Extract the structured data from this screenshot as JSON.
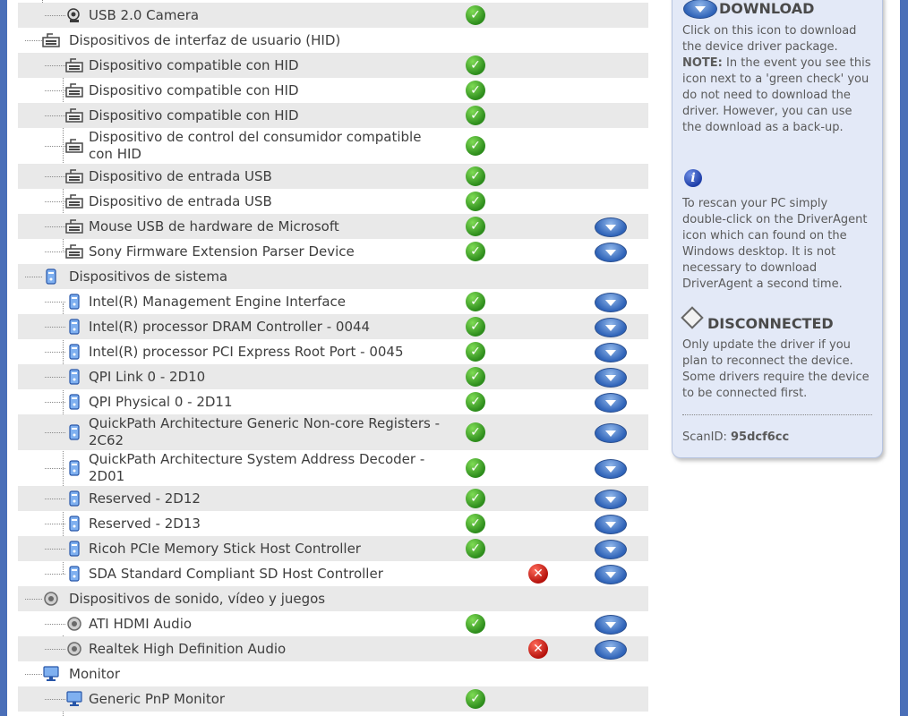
{
  "tree_rows": [
    {
      "label": "USB 2.0 Camera",
      "icon": "camera-icon",
      "level": 1,
      "ok": true,
      "err": false,
      "download": false
    },
    {
      "label": "Dispositivos de interfaz de usuario (HID)",
      "icon": "keyboard-icon",
      "level": 0,
      "ok": false,
      "err": false,
      "download": false
    },
    {
      "label": "Dispositivo compatible con HID",
      "icon": "keyboard-icon",
      "level": 1,
      "ok": true,
      "err": false,
      "download": false
    },
    {
      "label": "Dispositivo compatible con HID",
      "icon": "keyboard-icon",
      "level": 1,
      "ok": true,
      "err": false,
      "download": false
    },
    {
      "label": "Dispositivo compatible con HID",
      "icon": "keyboard-icon",
      "level": 1,
      "ok": true,
      "err": false,
      "download": false
    },
    {
      "label": "Dispositivo de control del consumidor compatible con HID",
      "icon": "keyboard-icon",
      "level": 1,
      "ok": true,
      "err": false,
      "download": false
    },
    {
      "label": "Dispositivo de entrada USB",
      "icon": "keyboard-icon",
      "level": 1,
      "ok": true,
      "err": false,
      "download": false
    },
    {
      "label": "Dispositivo de entrada USB",
      "icon": "keyboard-icon",
      "level": 1,
      "ok": true,
      "err": false,
      "download": false
    },
    {
      "label": "Mouse USB de hardware de Microsoft",
      "icon": "keyboard-icon",
      "level": 1,
      "ok": true,
      "err": false,
      "download": true
    },
    {
      "label": "Sony Firmware Extension Parser Device",
      "icon": "keyboard-icon",
      "level": 1,
      "ok": true,
      "err": false,
      "download": true
    },
    {
      "label": "Dispositivos de sistema",
      "icon": "computer-icon",
      "level": 0,
      "ok": false,
      "err": false,
      "download": false
    },
    {
      "label": "Intel(R) Management Engine Interface",
      "icon": "computer-icon",
      "level": 1,
      "ok": true,
      "err": false,
      "download": true
    },
    {
      "label": "Intel(R) processor DRAM Controller - 0044",
      "icon": "computer-icon",
      "level": 1,
      "ok": true,
      "err": false,
      "download": true
    },
    {
      "label": "Intel(R) processor PCI Express Root Port - 0045",
      "icon": "computer-icon",
      "level": 1,
      "ok": true,
      "err": false,
      "download": true
    },
    {
      "label": "QPI Link 0 - 2D10",
      "icon": "computer-icon",
      "level": 1,
      "ok": true,
      "err": false,
      "download": true
    },
    {
      "label": "QPI Physical 0 - 2D11",
      "icon": "computer-icon",
      "level": 1,
      "ok": true,
      "err": false,
      "download": true
    },
    {
      "label": "QuickPath Architecture Generic Non-core Registers - 2C62",
      "icon": "computer-icon",
      "level": 1,
      "ok": true,
      "err": false,
      "download": true
    },
    {
      "label": "QuickPath Architecture System Address Decoder - 2D01",
      "icon": "computer-icon",
      "level": 1,
      "ok": true,
      "err": false,
      "download": true
    },
    {
      "label": "Reserved - 2D12",
      "icon": "computer-icon",
      "level": 1,
      "ok": true,
      "err": false,
      "download": true
    },
    {
      "label": "Reserved - 2D13",
      "icon": "computer-icon",
      "level": 1,
      "ok": true,
      "err": false,
      "download": true
    },
    {
      "label": "Ricoh PCIe Memory Stick Host Controller",
      "icon": "computer-icon",
      "level": 1,
      "ok": true,
      "err": false,
      "download": true
    },
    {
      "label": "SDA Standard Compliant SD Host Controller",
      "icon": "computer-icon",
      "level": 1,
      "ok": false,
      "err": true,
      "download": true
    },
    {
      "label": "Dispositivos de sonido, vídeo y juegos",
      "icon": "speaker-icon",
      "level": 0,
      "ok": false,
      "err": false,
      "download": false
    },
    {
      "label": "ATI HDMI Audio",
      "icon": "speaker-icon",
      "level": 1,
      "ok": true,
      "err": false,
      "download": true
    },
    {
      "label": "Realtek High Definition Audio",
      "icon": "speaker-icon",
      "level": 1,
      "ok": false,
      "err": true,
      "download": true
    },
    {
      "label": "Monitor",
      "icon": "monitor-icon",
      "level": 0,
      "ok": false,
      "err": false,
      "download": false
    },
    {
      "label": "Generic PnP Monitor",
      "icon": "monitor-icon",
      "level": 1,
      "ok": true,
      "err": false,
      "download": false
    }
  ],
  "panel": {
    "download_heading": "DOWNLOAD",
    "download_text": "Click on this icon to download the device driver package.",
    "note_label": "NOTE:",
    "note_text": " In the event you see this icon next to a 'green check' you do not need to download the driver. However, you can use the download as a back-up.",
    "rescan_text": "To rescan your PC simply double-click on the DriverAgent icon which can found on the Windows desktop. It is not necessary to download DriverAgent a second time.",
    "disconnected_heading": "DISCONNECTED",
    "disconnected_text": "Only update the driver if you plan to reconnect the device. Some drivers require the device to be connected first.",
    "scan_label": "ScanID:",
    "scan_id": "95dcf6cc",
    "info_glyph": "i"
  },
  "colors": {
    "frame": "#4a6fb8",
    "row_shade": "#e9e9e9",
    "ok": "#2d8c1c",
    "error": "#b5120c",
    "download": "#2f63b8",
    "panel_bg": "#e3e9f7"
  }
}
